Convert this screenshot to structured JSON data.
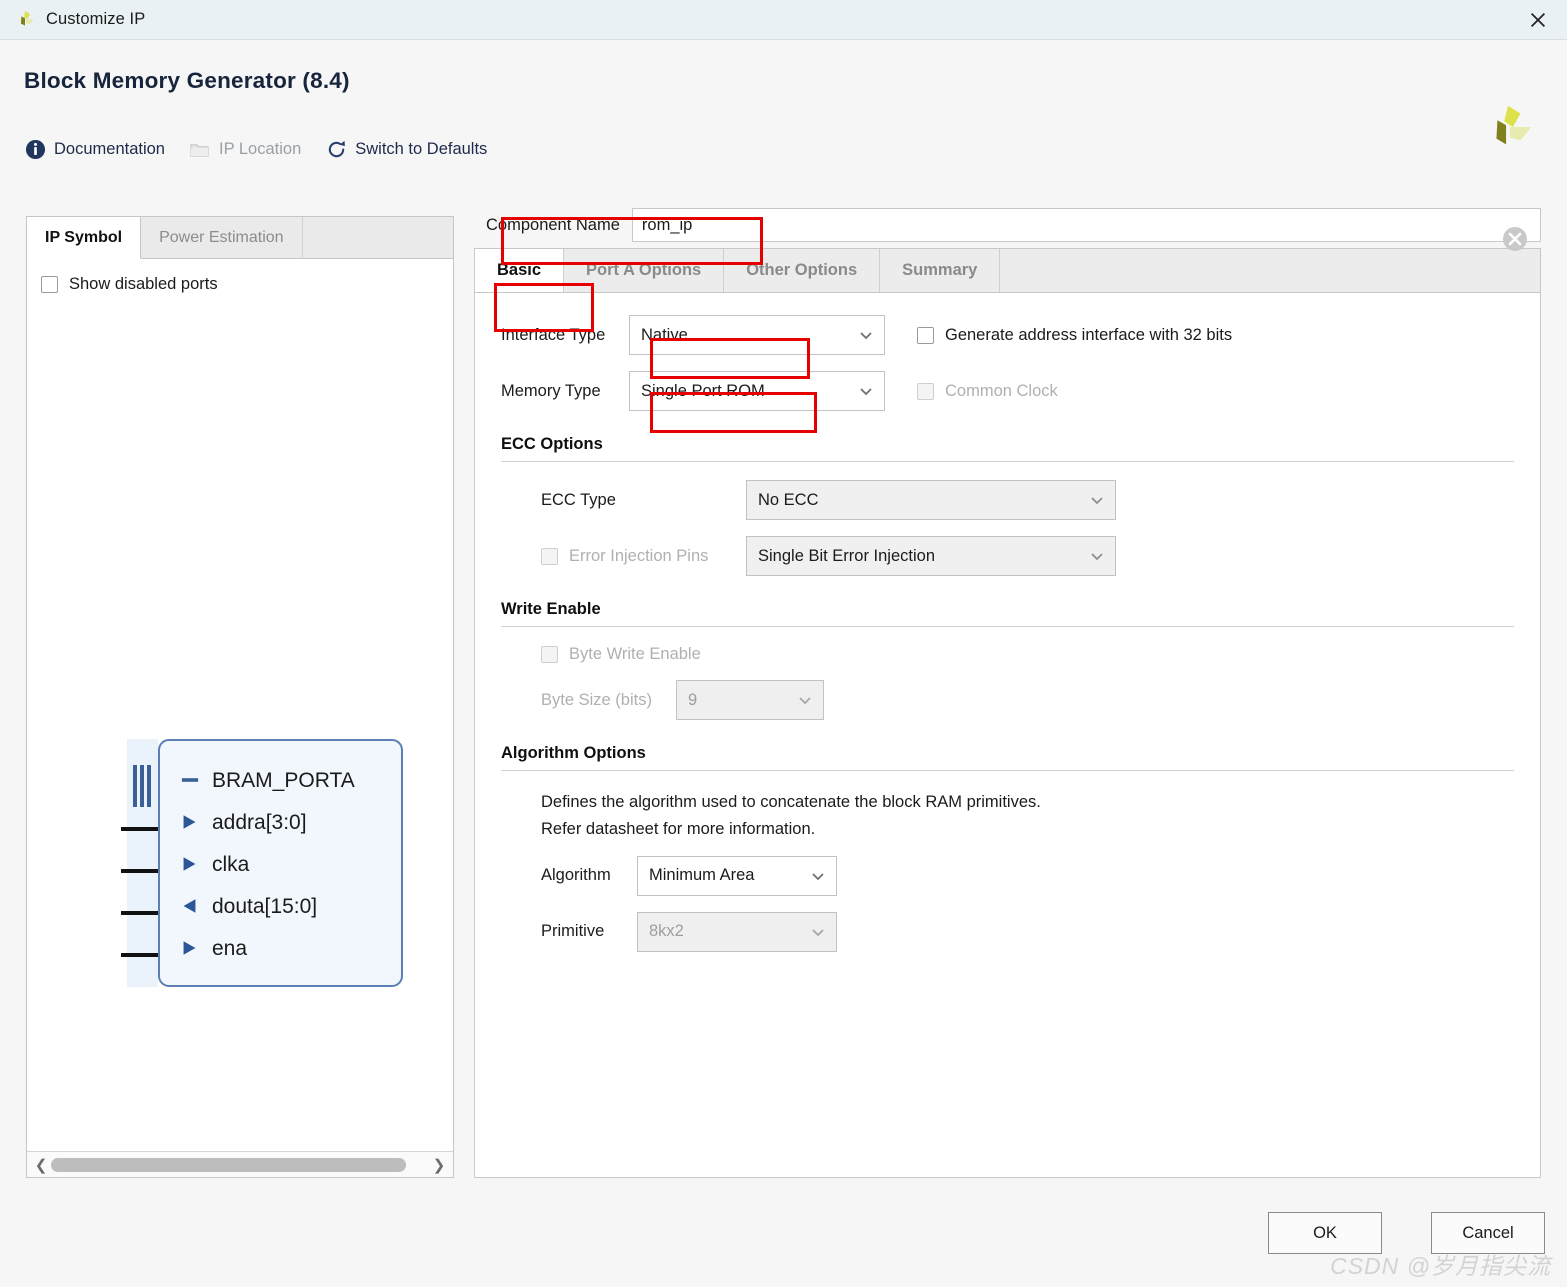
{
  "window": {
    "title": "Customize IP",
    "close_icon": "close-x-icon",
    "app_logo": "xilinx-pinwheel-logo"
  },
  "header": {
    "title": "Block Memory Generator (8.4)",
    "logo": "xilinx-pinwheel-logo",
    "toolbar": [
      {
        "label": "Documentation",
        "icon": "info-circle-icon",
        "disabled": false
      },
      {
        "label": "IP Location",
        "icon": "folder-icon",
        "disabled": true
      },
      {
        "label": "Switch to Defaults",
        "icon": "refresh-circular-arrow-icon",
        "disabled": false
      }
    ]
  },
  "left_panel": {
    "tabs": [
      {
        "label": "IP Symbol",
        "active": true
      },
      {
        "label": "Power Estimation",
        "active": false
      }
    ],
    "show_disabled_ports": {
      "label": "Show disabled ports",
      "checked": false
    },
    "symbol": {
      "bus_label": "BRAM_PORTA",
      "ports": [
        {
          "name": "addra[3:0]",
          "direction": "input"
        },
        {
          "name": "clka",
          "direction": "input"
        },
        {
          "name": "douta[15:0]",
          "direction": "output"
        },
        {
          "name": "ena",
          "direction": "input"
        }
      ]
    },
    "scrollbar": {
      "left_arrow": "chevron-left-icon",
      "right_arrow": "chevron-right-icon"
    }
  },
  "right_panel": {
    "component_name": {
      "label": "Component Name",
      "value": "rom_ip",
      "clear_icon": "clear-circle-x-icon"
    },
    "tabs": [
      {
        "label": "Basic",
        "active": true
      },
      {
        "label": "Port A Options",
        "active": false
      },
      {
        "label": "Other Options",
        "active": false
      },
      {
        "label": "Summary",
        "active": false
      }
    ],
    "basic": {
      "interface_type": {
        "label": "Interface Type",
        "value": "Native"
      },
      "memory_type": {
        "label": "Memory Type",
        "value": "Single Port ROM"
      },
      "generate_address_interface": {
        "label": "Generate address interface with 32 bits",
        "checked": false,
        "disabled": false
      },
      "common_clock": {
        "label": "Common Clock",
        "checked": false,
        "disabled": true
      },
      "ecc_options": {
        "heading": "ECC Options",
        "ecc_type": {
          "label": "ECC Type",
          "value": "No ECC"
        },
        "error_injection_pins": {
          "label": "Error Injection Pins",
          "checked": false,
          "disabled": true
        },
        "error_injection_type": {
          "value": "Single Bit Error Injection"
        }
      },
      "write_enable": {
        "heading": "Write Enable",
        "byte_write_enable": {
          "label": "Byte Write Enable",
          "checked": false,
          "disabled": true
        },
        "byte_size": {
          "label": "Byte Size (bits)",
          "value": "9"
        }
      },
      "algorithm_options": {
        "heading": "Algorithm Options",
        "description_line1": "Defines the algorithm used to concatenate the block RAM primitives.",
        "description_line2": "Refer datasheet for more information.",
        "algorithm": {
          "label": "Algorithm",
          "value": "Minimum Area"
        },
        "primitive": {
          "label": "Primitive",
          "value": "8kx2"
        }
      }
    }
  },
  "footer": {
    "ok_label": "OK",
    "cancel_label": "Cancel"
  },
  "watermark": "CSDN @岁月指尖流",
  "colors": {
    "titlebar_bg": "#e9f1f5",
    "body_bg": "#f6f6f6",
    "annotation_red": "#e60000",
    "symbol_border": "#5b7fb5",
    "symbol_fill": "#f2f7fd",
    "link_text": "#1e2a4a"
  }
}
